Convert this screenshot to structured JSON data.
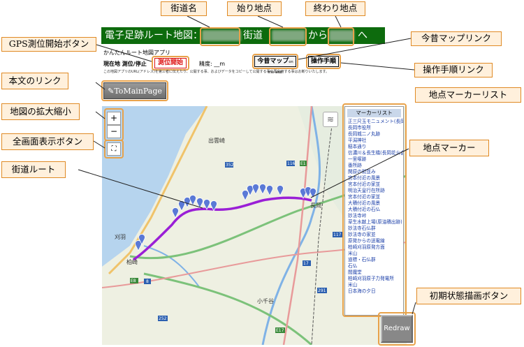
{
  "header": {
    "title_prefix": "電子足跡ルート地図：",
    "road_suffix": "街道",
    "from_text": "から",
    "to_text": "へ"
  },
  "subtitle": "かんたんルート地図アプリ",
  "gps": {
    "label": "現在地 測位/停止",
    "button": "測位開始",
    "accuracy_label": "精度: __m"
  },
  "notice": "この地図アプリのURL(アドレス)を第三者に伝えたり、公開する事、およびデータをコピーして公開する事や再利用する事はお断りいたします。",
  "links": {
    "konjaku": "今昔マップ",
    "konjaku_sub": "on the web",
    "manual": "操作手順"
  },
  "to_main_page": "ToMainPage",
  "map": {
    "zoom_in": "+",
    "zoom_out": "−",
    "fullscreen": "⛶",
    "places": [
      "出雲崎",
      "長岡",
      "柏崎",
      "小千谷",
      "刈羽"
    ],
    "route_labels": [
      "352",
      "116",
      "8",
      "17",
      "117",
      "252",
      "291",
      "351",
      "E8",
      "E17",
      "E1"
    ]
  },
  "marker_list": {
    "title": "マーカーリスト",
    "items": [
      "正三尺玉モニュメント(長岡駅前)",
      "長岡市役所",
      "長岡城二ノ丸跡",
      "平潟神社",
      "稲本通り",
      "信濃川＆長生橋(長岡花火会場)",
      "一里塚跡",
      "番所跡",
      "関原の街並み",
      "宮本付近の風景",
      "宮本付近の家並",
      "明治天皇行在所跡",
      "宮本付近の家並",
      "大積付近の風景",
      "大積付近の石仏",
      "妙法寺峠",
      "草生水献上場(原油積出跡)",
      "妙法寺石仏群",
      "妙法寺の家並",
      "原発からの送電線",
      "柏崎刈羽原発方面",
      "米山",
      "道標・石仏群",
      "石仏",
      "閻魔堂",
      "柏崎刈羽原子力発電所",
      "米山",
      "日本海の夕日"
    ]
  },
  "redraw": "Redraw",
  "callouts": {
    "road_name": "街道名",
    "start_point": "始り地点",
    "end_point": "終わり地点",
    "gps_button": "GPS測位開始ボタン",
    "konjaku_link": "今昔マップリンク",
    "manual_link": "操作手順リンク",
    "main_link": "本文のリンク",
    "zoom": "地図の拡大縮小",
    "fullscreen": "全画面表示ボタン",
    "route": "街道ルート",
    "marker_list": "地点マーカーリスト",
    "marker": "地点マーカー",
    "redraw": "初期状態描画ボタン"
  },
  "colors": {
    "header_bg": "#0d6b0d",
    "callout_border": "#e08a24",
    "callout_bg": "#fff0dc",
    "route": "#9a1fd6",
    "marker": "#5a79d6"
  }
}
